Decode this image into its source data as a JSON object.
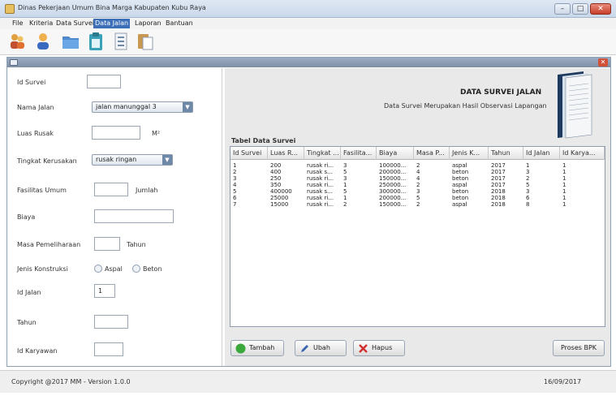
{
  "window": {
    "title": "Dinas Pekerjaan Umum Bina Marga Kabupaten Kubu Raya",
    "min": "–",
    "max": "□",
    "close": "✕"
  },
  "menu": [
    "File",
    "Kriteria",
    "Data Survei",
    "Data Jalan",
    "Laporan",
    "Bantuan"
  ],
  "menu_active": "Data Jalan",
  "toolbar_icons": [
    "users-icon",
    "user-icon",
    "folder-icon",
    "clipboard-icon",
    "document-list-icon",
    "paste-icon"
  ],
  "form": {
    "id_survei_label": "Id Survei",
    "id_survei_value": "",
    "nama_jalan_label": "Nama Jalan",
    "nama_jalan_value": "jalan manunggal 3",
    "luas_rusak_label": "Luas Rusak",
    "luas_rusak_value": "",
    "luas_unit": "M²",
    "tingkat_label": "Tingkat Kerusakan",
    "tingkat_value": "rusak ringan",
    "fasilitas_label": "Fasilitas Umum",
    "fasilitas_value": "",
    "fasilitas_unit": "Jumlah",
    "biaya_label": "Biaya",
    "biaya_value": "",
    "masa_label": "Masa Pemeliharaan",
    "masa_value": "",
    "masa_unit": "Tahun",
    "jenis_label": "Jenis Konstruksi",
    "jenis_opt1": "Aspal",
    "jenis_opt2": "Beton",
    "idjalan_label": "Id Jalan",
    "idjalan_value": "1",
    "tahun_label": "Tahun",
    "tahun_value": "",
    "idkaryawan_label": "Id Karyawan",
    "idkaryawan_value": ""
  },
  "header": {
    "title": "DATA SURVEI JALAN",
    "subtitle": "Data Survei Merupakan Hasil Observasi Lapangan"
  },
  "table": {
    "caption": "Tabel Data Survei",
    "columns": [
      "Id Survei",
      "Luas R...",
      "Tingkat ...",
      "Fasilita...",
      "Biaya",
      "Masa P...",
      "Jenis K...",
      "Tahun",
      "Id Jalan",
      "Id Karya..."
    ],
    "rows": [
      [
        "1",
        "200",
        "rusak ri...",
        "3",
        "100000...",
        "2",
        "aspal",
        "2017",
        "1",
        "1"
      ],
      [
        "2",
        "400",
        "rusak s...",
        "5",
        "200000...",
        "4",
        "beton",
        "2017",
        "3",
        "1"
      ],
      [
        "3",
        "250",
        "rusak ri...",
        "3",
        "150000...",
        "4",
        "beton",
        "2017",
        "2",
        "1"
      ],
      [
        "4",
        "350",
        "rusak ri...",
        "1",
        "250000...",
        "2",
        "aspal",
        "2017",
        "5",
        "1"
      ],
      [
        "5",
        "400000",
        "rusak s...",
        "5",
        "300000...",
        "3",
        "beton",
        "2018",
        "3",
        "1"
      ],
      [
        "6",
        "25000",
        "rusak ri...",
        "1",
        "200000...",
        "5",
        "beton",
        "2018",
        "6",
        "1"
      ],
      [
        "7",
        "15000",
        "rusak ri...",
        "2",
        "150000...",
        "2",
        "aspal",
        "2018",
        "8",
        "1"
      ]
    ]
  },
  "buttons": {
    "tambah": "Tambah",
    "ubah": "Ubah",
    "hapus": "Hapus",
    "proses": "Proses BPK"
  },
  "status": {
    "copyright": "Copyright @2017 MM - Version 1.0.0",
    "date": "16/09/2017"
  },
  "colors": {
    "accent": "#3c6fb8",
    "tambah_icon": "#3aa83a",
    "hapus_icon": "#d03030",
    "ubah_icon": "#3a66b0"
  }
}
